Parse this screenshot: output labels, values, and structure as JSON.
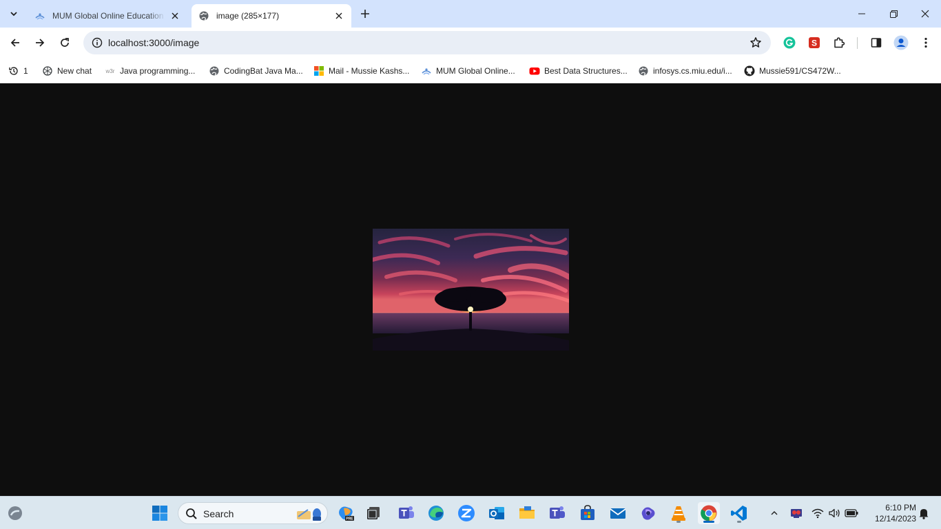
{
  "tabs": [
    {
      "title": "MUM Global Online Education",
      "active": false
    },
    {
      "title": "image (285×177)",
      "active": true
    }
  ],
  "toolbar": {
    "url": "localhost:3000/image"
  },
  "bookmarks": [
    {
      "label": "1",
      "icon": "history-icon"
    },
    {
      "label": "New chat",
      "icon": "openai-icon"
    },
    {
      "label": "Java programming...",
      "icon": "w3schools-icon"
    },
    {
      "label": "CodingBat Java Ma...",
      "icon": "globe-icon"
    },
    {
      "label": "Mail - Mussie Kashs...",
      "icon": "microsoft-icon"
    },
    {
      "label": "MUM Global Online...",
      "icon": "mum-icon"
    },
    {
      "label": "Best Data Structures...",
      "icon": "youtube-icon"
    },
    {
      "label": "infosys.cs.miu.edu/i...",
      "icon": "globe-icon"
    },
    {
      "label": "Mussie591/CS472W...",
      "icon": "github-icon"
    }
  ],
  "content": {
    "image_alt": "Tree silhouette at sunset",
    "image_size": "285×177"
  },
  "taskbar": {
    "search_placeholder": "Search",
    "time": "6:10 PM",
    "date": "12/14/2023"
  },
  "colors": {
    "tabstrip": "#d3e3fd",
    "omnibox": "#e9eef6",
    "page_bg": "#0e0e0e",
    "taskbar": "#dbe7ef",
    "accent": "#0b57d0"
  }
}
